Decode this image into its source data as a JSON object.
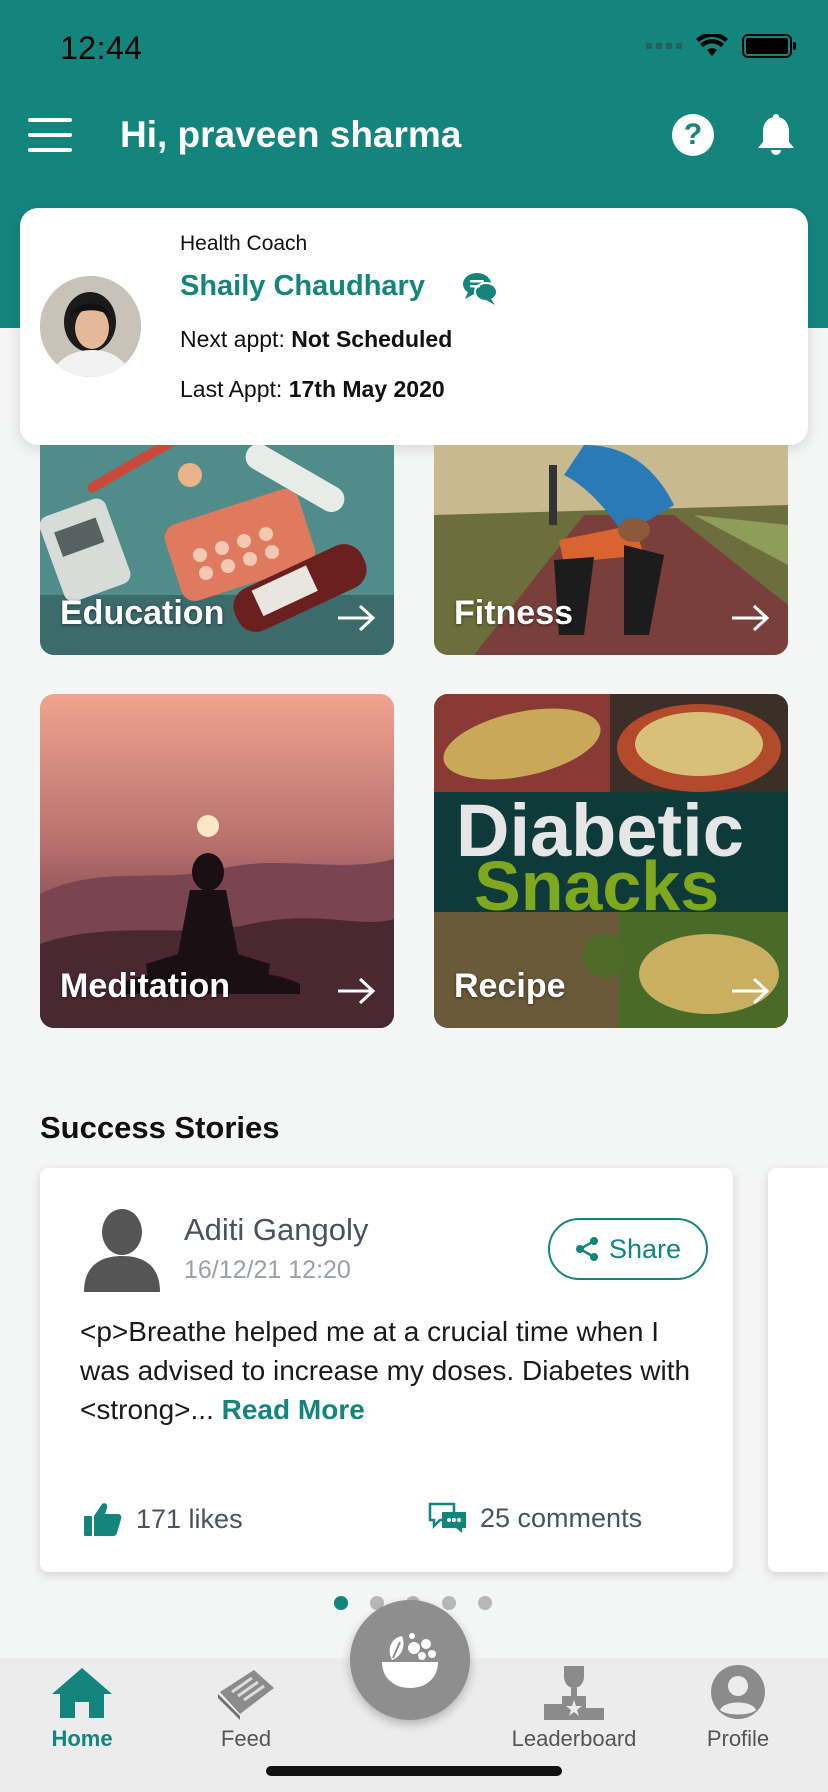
{
  "status_bar": {
    "time": "12:44"
  },
  "header": {
    "greeting": "Hi, praveen sharma"
  },
  "coach": {
    "role": "Health Coach",
    "name": "Shaily Chaudhary",
    "next_label": "Next appt: ",
    "next_value": "Not Scheduled",
    "last_label": "Last Appt: ",
    "last_value": "17th May 2020"
  },
  "tiles": [
    {
      "label": "Education"
    },
    {
      "label": "Fitness"
    },
    {
      "label": "Meditation"
    },
    {
      "label": "Recipe",
      "art_line1": "Diabetic",
      "art_line2": "Snacks"
    }
  ],
  "success_stories": {
    "title": "Success Stories",
    "story": {
      "author": "Aditi Gangoly",
      "date": "16/12/21  12:20",
      "share_label": "Share",
      "excerpt": "<p>Breathe helped me at a crucial time when I was advised to increase my doses. Diabetes with <strong>... ",
      "read_more": "Read More",
      "likes": "171 likes",
      "comments": "25 comments"
    },
    "page_count": 5,
    "active_page": 1
  },
  "bottom_nav": {
    "items": [
      {
        "label": "Home"
      },
      {
        "label": "Feed"
      },
      {
        "label": "Leaderboard"
      },
      {
        "label": "Profile"
      }
    ]
  },
  "colors": {
    "primary": "#14857d",
    "background": "#f4f5f5"
  }
}
